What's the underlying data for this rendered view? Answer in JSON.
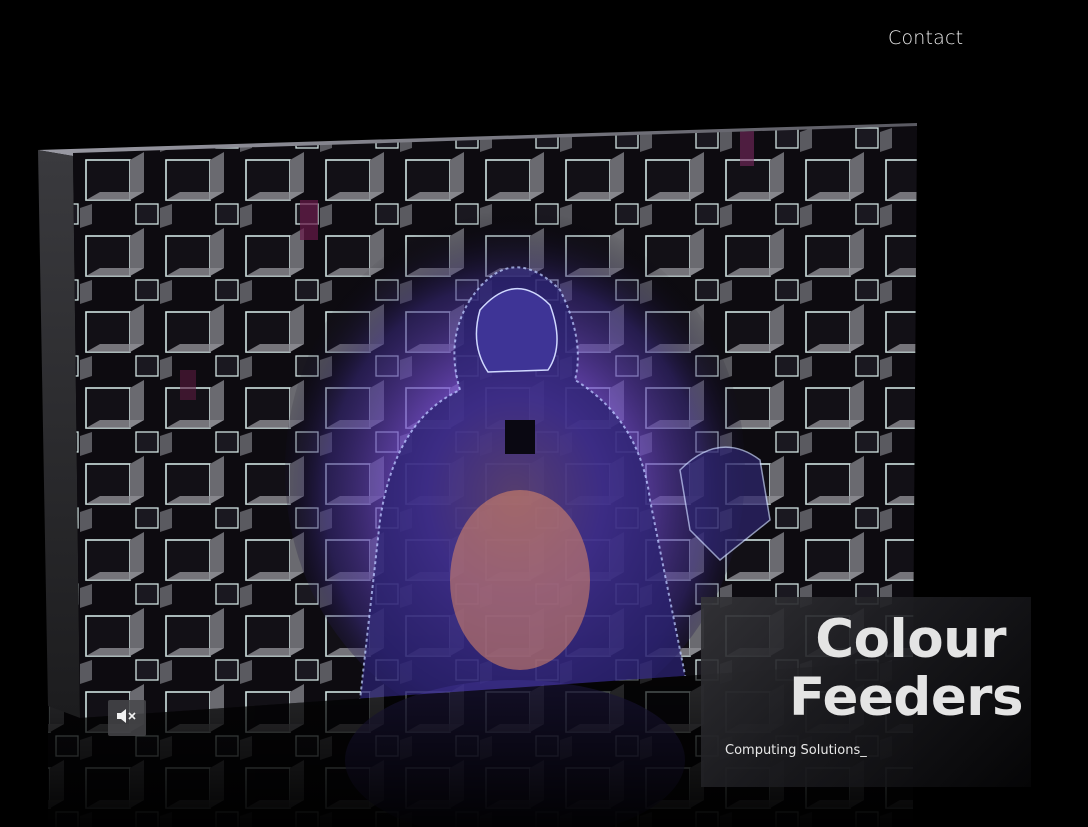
{
  "nav": {
    "contact_label": "Contact"
  },
  "hero": {
    "title_line_1": "Colour",
    "title_line_2": "Feeders",
    "subtitle": "Computing Solutions_"
  },
  "video": {
    "mute_icon": "speaker-muted-icon",
    "muted": true
  },
  "colors": {
    "background": "#000000",
    "title_text": "#e4e4e4",
    "figure_glow": "#7b5cff",
    "figure_warm": "#e8906a"
  }
}
